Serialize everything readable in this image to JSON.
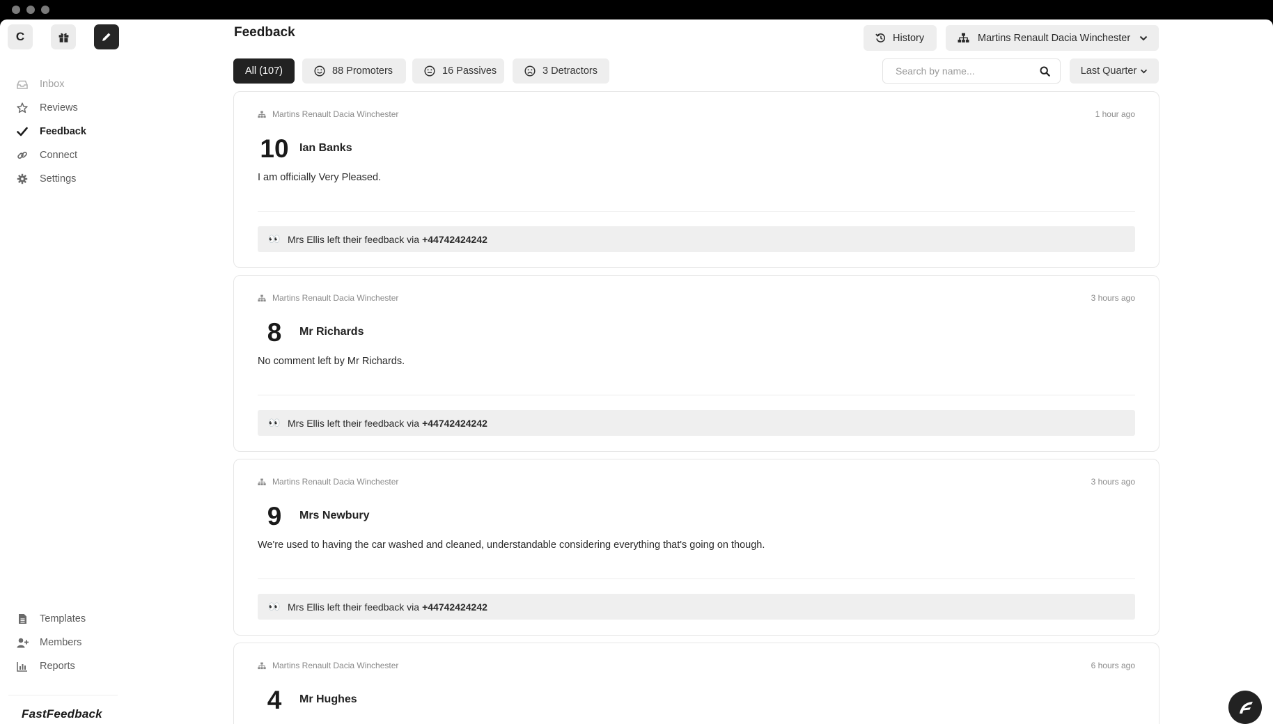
{
  "app": {
    "page_title": "Feedback",
    "brand": "FastFeedback",
    "avatar_letter": "C"
  },
  "sidebar": {
    "items": [
      {
        "label": "Inbox",
        "icon": "inbox-icon"
      },
      {
        "label": "Reviews",
        "icon": "star-icon"
      },
      {
        "label": "Feedback",
        "icon": "check-icon"
      },
      {
        "label": "Connect",
        "icon": "link-icon"
      },
      {
        "label": "Settings",
        "icon": "gear-icon"
      }
    ],
    "bottom_items": [
      {
        "label": "Templates",
        "icon": "document-icon"
      },
      {
        "label": "Members",
        "icon": "add-user-icon"
      },
      {
        "label": "Reports",
        "icon": "bar-chart-icon"
      }
    ]
  },
  "header": {
    "history_label": "History",
    "location_label": "Martins Renault Dacia Winchester"
  },
  "filters": {
    "all_label": "All (107)",
    "promoters_label": "88 Promoters",
    "passives_label": "16 Passives",
    "detractors_label": "3 Detractors",
    "search_placeholder": "Search by name...",
    "period_label": "Last Quarter"
  },
  "feed": [
    {
      "location": "Martins Renault Dacia Winchester",
      "time": "1 hour ago",
      "score": "10",
      "name": "Ian Banks",
      "comment": "I am officially Very Pleased.",
      "via_text": "Mrs Ellis left their feedback via",
      "via_phone": "+44742424242"
    },
    {
      "location": "Martins Renault Dacia Winchester",
      "time": "3 hours ago",
      "score": "8",
      "name": "Mr Richards",
      "comment": "No comment left by Mr Richards.",
      "via_text": "Mrs Ellis left their feedback via",
      "via_phone": "+44742424242"
    },
    {
      "location": "Martins Renault Dacia Winchester",
      "time": "3 hours ago",
      "score": "9",
      "name": "Mrs Newbury",
      "comment": "We're used to having the car washed and cleaned, understandable considering everything that's going on though.",
      "via_text": "Mrs Ellis left their feedback via",
      "via_phone": "+44742424242"
    },
    {
      "location": "Martins Renault Dacia Winchester",
      "time": "6 hours ago",
      "score": "4",
      "name": "Mr Hughes"
    }
  ]
}
